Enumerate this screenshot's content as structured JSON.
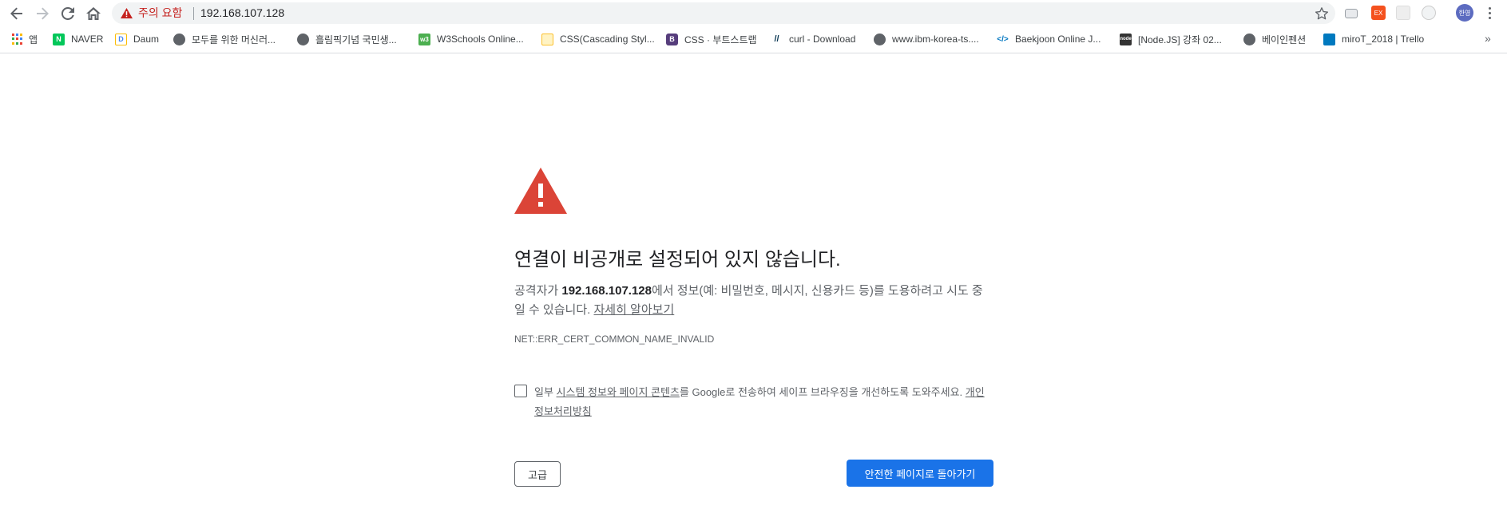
{
  "toolbar": {
    "back_icon": "arrow-left-icon",
    "forward_icon": "arrow-right-icon",
    "reload_icon": "reload-icon",
    "home_icon": "home-icon",
    "security_label": "주의 요함",
    "url": "192.168.107.128",
    "profile_label": "한영"
  },
  "bookmarks": [
    {
      "label": "앱",
      "icon": "apps-grid-icon",
      "color": "#e53935"
    },
    {
      "label": "NAVER",
      "icon": "naver-icon",
      "color": "#03c75a"
    },
    {
      "label": "Daum",
      "icon": "daum-icon",
      "color": "#4285f4"
    },
    {
      "label": "모두를 위한 머신러...",
      "icon": "globe-icon",
      "color": "#5f6368"
    },
    {
      "label": "흘림픽기념 국민생...",
      "icon": "globe-icon",
      "color": "#5f6368"
    },
    {
      "label": "W3Schools Online...",
      "icon": "w3schools-icon",
      "color": "#4caf50"
    },
    {
      "label": "CSS(Cascading Styl...",
      "icon": "page-icon",
      "color": "#fbc02d"
    },
    {
      "label": "CSS · 부트스트랩",
      "icon": "bootstrap-icon",
      "color": "#563d7c"
    },
    {
      "label": "curl - Download",
      "icon": "curl-icon",
      "color": "#073551"
    },
    {
      "label": "www.ibm-korea-ts....",
      "icon": "globe-icon",
      "color": "#5f6368"
    },
    {
      "label": "Baekjoon Online J...",
      "icon": "code-icon",
      "color": "#0076c0"
    },
    {
      "label": "[Node.JS] 강좌 02...",
      "icon": "node-icon",
      "color": "#333333"
    },
    {
      "label": "베이인펜션",
      "icon": "globe-icon",
      "color": "#5f6368"
    },
    {
      "label": "miroT_2018 | Trello",
      "icon": "trello-icon",
      "color": "#0079bf"
    }
  ],
  "interstitial": {
    "heading": "연결이 비공개로 설정되어 있지 않습니다.",
    "desc_prefix": "공격자가 ",
    "desc_host": "192.168.107.128",
    "desc_suffix": "에서 정보(예: 비밀번호, 메시지, 신용카드 등)를 도용하려고 시도 중일 수 있습니다. ",
    "learn_more": "자세히 알아보기",
    "error_code": "NET::ERR_CERT_COMMON_NAME_INVALID",
    "checkbox_prefix": "일부 ",
    "checkbox_link": "시스템 정보와 페이지 콘텐츠",
    "checkbox_suffix": "를 Google로 전송하여 세이프 브라우징을 개선하도록 도와주세요. ",
    "privacy_link": "개인정보처리방침",
    "advanced_button": "고급",
    "back_button": "안전한 페이지로 돌아가기"
  },
  "colors": {
    "warning_red": "#db4437",
    "primary_blue": "#1a73e8"
  }
}
